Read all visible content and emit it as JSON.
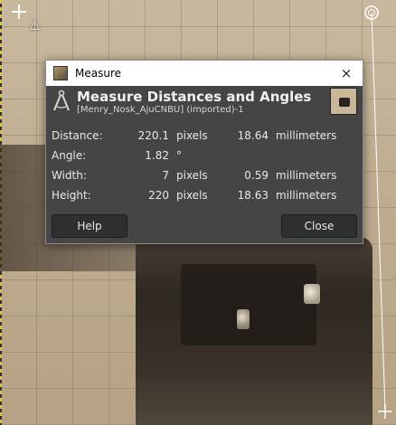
{
  "dialog": {
    "window_title": "Measure",
    "heading": "Measure Distances and Angles",
    "subheading": "[Menry_Nosk_AjuCNBU] (imported)-1",
    "close_icon": "×",
    "tool_icon": "compass-icon",
    "measurements": [
      {
        "label": "Distance:",
        "value": "220.1",
        "unit": "pixels",
        "value2": "18.64",
        "unit2": "millimeters"
      },
      {
        "label": "Angle:",
        "value": "1.82",
        "unit": "°",
        "value2": "",
        "unit2": ""
      },
      {
        "label": "Width:",
        "value": "7",
        "unit": "pixels",
        "value2": "0.59",
        "unit2": "millimeters"
      },
      {
        "label": "Height:",
        "value": "220",
        "unit": "pixels",
        "value2": "18.63",
        "unit2": "millimeters"
      }
    ],
    "help_label": "Help",
    "close_label": "Close"
  },
  "colors": {
    "dialog_bg": "#454545",
    "button_bg": "#2f2f2f",
    "measure_line": "#ffffff"
  }
}
